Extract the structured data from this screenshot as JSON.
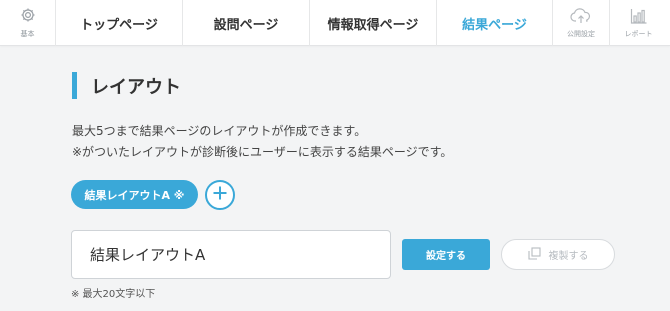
{
  "nav": {
    "basic_label": "基本",
    "tabs": [
      {
        "label": "トップページ"
      },
      {
        "label": "設問ページ"
      },
      {
        "label": "情報取得ページ"
      },
      {
        "label": "結果ページ"
      }
    ],
    "active_tab": "結果ページ",
    "publish_label": "公開設定",
    "report_label": "レポート"
  },
  "section": {
    "title": "レイアウト"
  },
  "description": {
    "line1": "最大5つまで結果ページのレイアウトが作成できます。",
    "line2": "※がついたレイアウトが診断後にユーザーに表示する結果ページです。"
  },
  "layouts": [
    {
      "label": "結果レイアウトA ※",
      "selected": true
    }
  ],
  "editor": {
    "name_value": "結果レイアウトA",
    "set_label": "設定する",
    "copy_label": "複製する",
    "note": "※ 最大20文字以下"
  },
  "colors": {
    "accent": "#3aa8d8",
    "background": "#f3f4f5"
  }
}
